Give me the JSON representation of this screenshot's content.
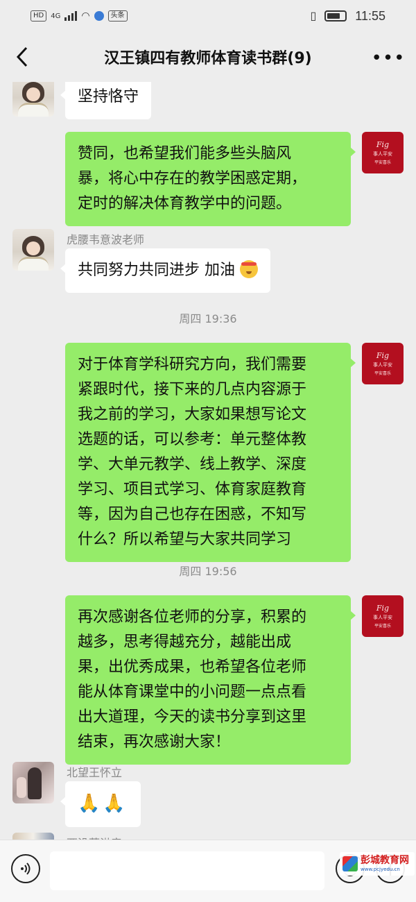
{
  "status_bar": {
    "left_badges": [
      "HD",
      "4G"
    ],
    "app_badge": "头条",
    "time": "11:55"
  },
  "header": {
    "back_icon": "chevron-left-icon",
    "title": "汉王镇四有教师体育读书群(9)",
    "more_icon": "more-dots-icon",
    "more_glyph": "•••"
  },
  "messages": [
    {
      "side": "left",
      "sender": "",
      "text": "坚持恪守"
    },
    {
      "side": "right",
      "text_lines": [
        "赞同，也希望我们能多些头脑风",
        "暴，将心中存在的教学困惑定期，",
        "定时的解决体育教学中的问题。"
      ]
    },
    {
      "side": "left",
      "sender": "虎腰韦意波老师",
      "text": "共同努力共同进步 加油"
    },
    {
      "type": "time",
      "text": "周四 19:36"
    },
    {
      "side": "right",
      "text_lines": [
        "对于体育学科研究方向，我们需要",
        "紧跟时代，接下来的几点内容源于",
        "我之前的学习，大家如果想写论文",
        "选题的话，可以参考：单元整体教",
        "学、大单元教学、线上教学、深度",
        "学习、项目式学习、体育家庭教育",
        "等，因为自己也存在困惑，不知写",
        "什么？所以希望与大家共同学习"
      ]
    },
    {
      "type": "time",
      "text": "周四 19:56"
    },
    {
      "side": "right",
      "text_lines": [
        "再次感谢各位老师的分享，积累的",
        "越多，思考得越充分，越能出成",
        "果，出优秀成果，也希望各位老师",
        "能从体育课堂中的小问题一点点看",
        "出大道理，今天的读书分享到这里",
        "结束，再次感谢大家！"
      ]
    },
    {
      "side": "left",
      "sender": "北望王怀立",
      "text": "🙏🙏"
    },
    {
      "side": "left",
      "sender": "西没薛洪章",
      "text": ""
    }
  ],
  "input_bar": {
    "voice_icon": "voice-icon",
    "input_value": "",
    "emoji_icon": "emoji-icon",
    "plus_icon": "plus-icon"
  },
  "watermark": {
    "title": "彭城教育网",
    "url": "www.pcjyedu.cn"
  }
}
